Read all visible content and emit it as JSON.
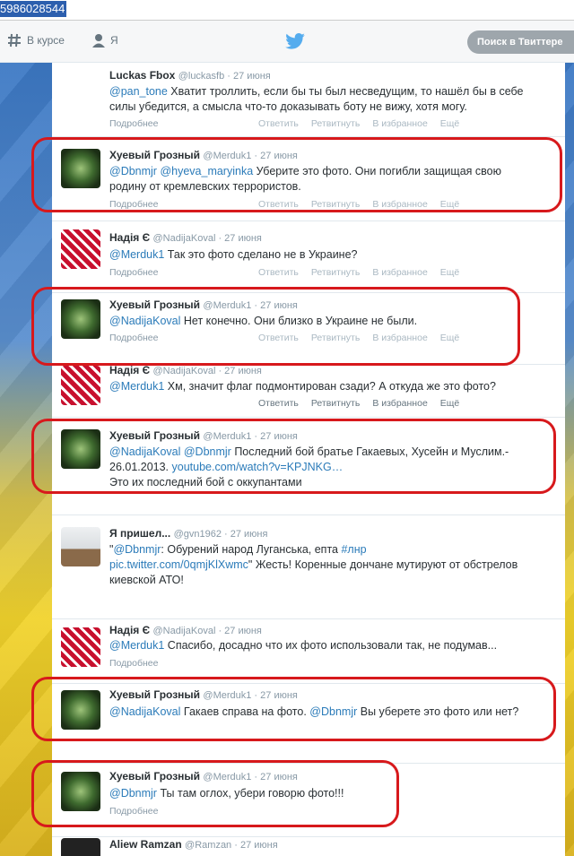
{
  "top_selection": "5986028544",
  "nav": {
    "home_label": "В курсе",
    "me_label": "Я",
    "search_placeholder": "Поиск в Твиттере"
  },
  "tweets": [
    {
      "name": "Luckas Fbox",
      "handle": "@luckasfb",
      "time": "27 июня",
      "body_mention": "@pan_tone",
      "body": " Хватит троллить, если бы ты был несведущим, то нашёл бы в себе силы убедится, а смысла что-то доказывать боту не вижу, хотя могу.",
      "more": "Подробнее",
      "reply": "Ответить",
      "retweet": "Ретвитнуть",
      "fav": "В избранное",
      "etc": "Ещё"
    },
    {
      "name": "Хуевый Грозный",
      "handle": "@Merduk1",
      "time": "27 июня",
      "body_mention": "@Dbnmjr @hyeva_maryinka",
      "body": " Уберите это фото. Они погибли защищая свою родину от кремлевских террористов.",
      "more": "Подробнее",
      "reply": "Ответить",
      "retweet": "Ретвитнуть",
      "fav": "В избранное",
      "etc": "Ещё"
    },
    {
      "name": "Надія Є",
      "handle": "@NadijaKoval",
      "time": "27 июня",
      "body_mention": "@Merduk1",
      "body": " Так это фото сделано не в Украине?",
      "more": "Подробнее",
      "reply": "Ответить",
      "retweet": "Ретвитнуть",
      "fav": "В избранное",
      "etc": "Ещё"
    },
    {
      "name": "Хуевый Грозный",
      "handle": "@Merduk1",
      "time": "27 июня",
      "body_mention": "@NadijaKoval",
      "body": " Нет конечно. Они близко в Украине не были.",
      "more": "Подробнее",
      "reply": "Ответить",
      "retweet": "Ретвитнуть",
      "fav": "В избранное",
      "etc": "Ещё"
    },
    {
      "name": "Надія Є",
      "handle": "@NadijaKoval",
      "time": "27 июня",
      "body_mention": "@Merduk1",
      "body": " Хм, значит флаг подмонтирован сзади? А откуда же это фото?",
      "more": "",
      "reply": "Ответить",
      "retweet": "Ретвитнуть",
      "fav": "В избранное",
      "etc": "Ещё"
    },
    {
      "name": "Хуевый Грозный",
      "handle": "@Merduk1",
      "time": "27 июня",
      "body_mention": "@NadijaKoval @Dbnmjr",
      "body": " Последний бой братье Гакаевых, Хусейн и Муслим.- 26.01.2013. ",
      "link": "youtube.com/watch?v=KPJNKG…",
      "body2": "Это их последний бой с оккупантами",
      "more": "",
      "reply": "",
      "retweet": "",
      "fav": "",
      "etc": ""
    },
    {
      "name": "Я пришел...",
      "handle": "@gvn1962",
      "time": "27 июня",
      "body_pre": "\"",
      "body_mention": "@Dbnmjr",
      "body": ": Обурений народ Луганська, епта ",
      "tag": "#лнр",
      "link": "pic.twitter.com/0qmjKlXwmc",
      "body2": "\" Жесть! Коренные дончане мутируют от обстрелов киевской АТО!",
      "more": "",
      "reply": "",
      "retweet": "",
      "fav": "",
      "etc": ""
    },
    {
      "name": "Надія Є",
      "handle": "@NadijaKoval",
      "time": "27 июня",
      "body_mention": "@Merduk1",
      "body": " Спасибо, досадно что их фото использовали так, не подумав...",
      "more": "Подробнее",
      "reply": "",
      "retweet": "",
      "fav": "",
      "etc": ""
    },
    {
      "name": "Хуевый Грозный",
      "handle": "@Merduk1",
      "time": "27 июня",
      "body_mention": "@NadijaKoval",
      "body": " Гакаев справа на фото.    ",
      "mention2": "@Dbnmjr",
      "body2": " Вы уберете это фото или нет?",
      "more": "",
      "reply": "",
      "retweet": "",
      "fav": "",
      "etc": ""
    },
    {
      "name": "Хуевый Грозный",
      "handle": "@Merduk1",
      "time": "27 июня",
      "body_mention": "@Dbnmjr",
      "body": " Ты там оглох, убери говорю фото!!!",
      "more": "Подробнее",
      "reply": "",
      "retweet": "",
      "fav": "",
      "etc": ""
    },
    {
      "name": "Aliew Ramzan",
      "handle": "@Ramzan",
      "time": "27 июня"
    }
  ]
}
